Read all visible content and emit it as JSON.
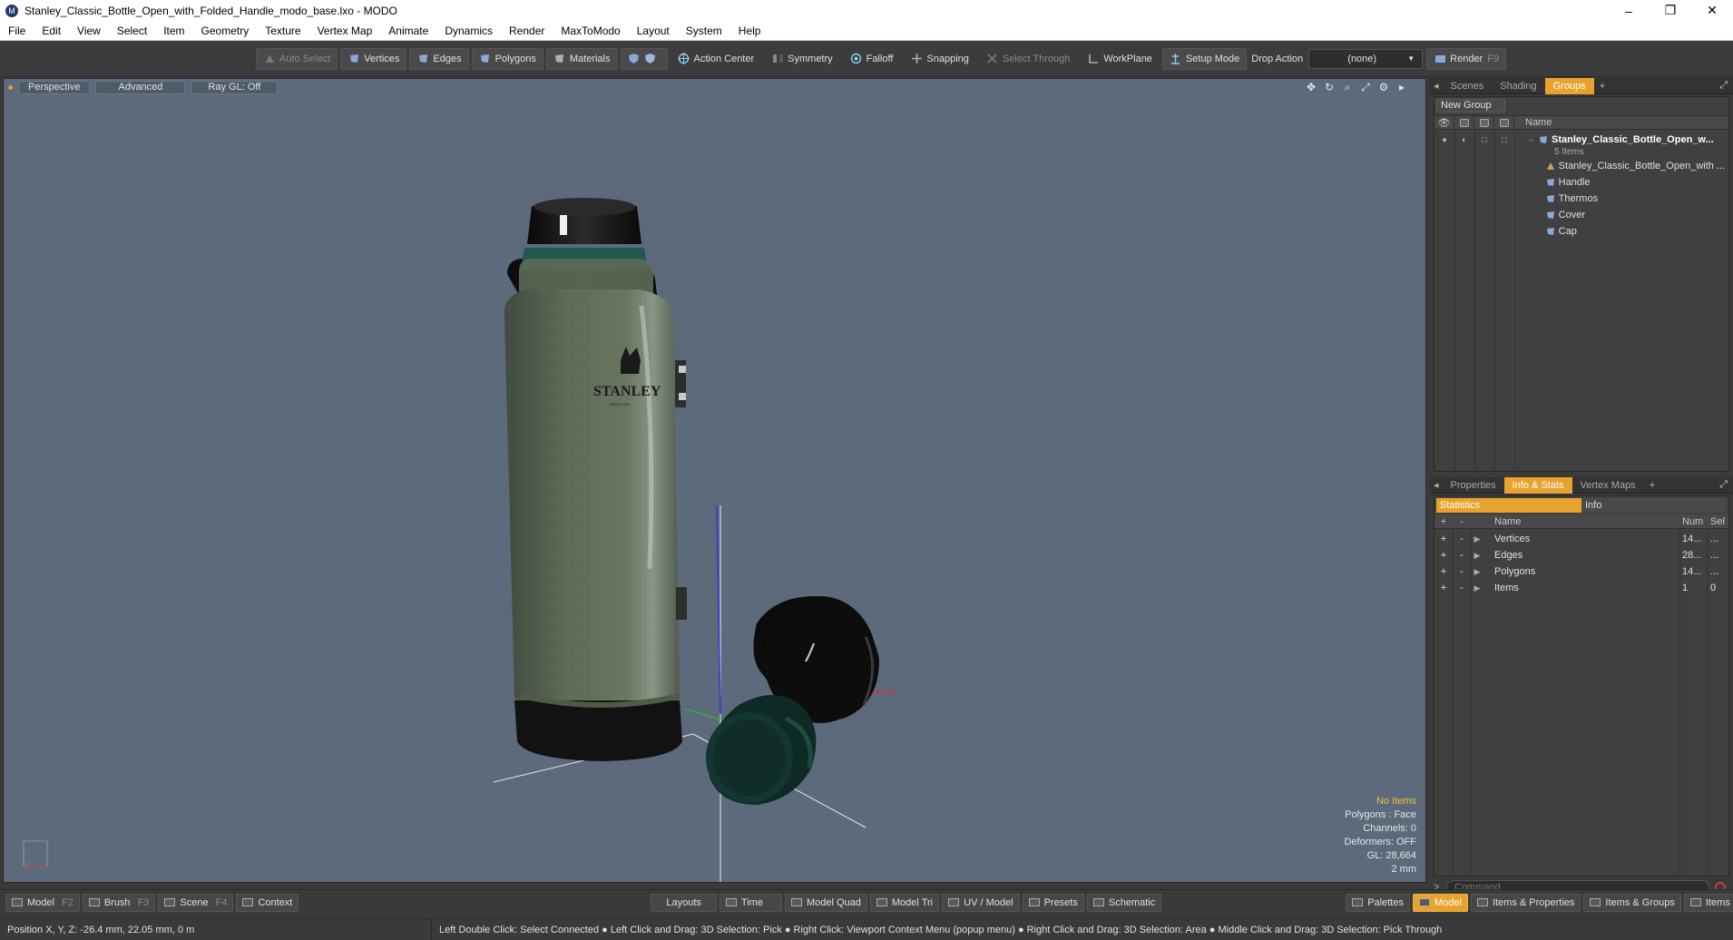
{
  "window": {
    "title": "Stanley_Classic_Bottle_Open_with_Folded_Handle_modo_base.lxo - MODO",
    "minimize": "–",
    "restore": "❐",
    "close": "✕"
  },
  "menu": [
    "File",
    "Edit",
    "View",
    "Select",
    "Item",
    "Geometry",
    "Texture",
    "Vertex Map",
    "Animate",
    "Dynamics",
    "Render",
    "MaxToModo",
    "Layout",
    "System",
    "Help"
  ],
  "toolbar": {
    "auto_select": "Auto Select",
    "vertices": "Vertices",
    "edges": "Edges",
    "polygons": "Polygons",
    "materials": "Materials",
    "action_center": "Action Center",
    "symmetry": "Symmetry",
    "falloff": "Falloff",
    "snapping": "Snapping",
    "select_through": "Select Through",
    "workplane": "WorkPlane",
    "setup_mode": "Setup Mode",
    "drop_action": "Drop Action",
    "drop_value": "(none)",
    "render": "Render",
    "render_key": "F9"
  },
  "viewport": {
    "tabs": [
      "Perspective",
      "Advanced",
      "Ray GL: Off"
    ],
    "info": {
      "items": "No Items",
      "polygons": "Polygons : Face",
      "channels": "Channels: 0",
      "deformers": "Deformers: OFF",
      "gl": "GL: 28,664",
      "scale": "2 mm"
    },
    "brand_text": "STANLEY",
    "brand_sub": "SINCE 1913"
  },
  "groups_panel": {
    "tabs": [
      "Scenes",
      "Shading",
      "Groups"
    ],
    "active_tab": "Groups",
    "new_group": "New Group",
    "name_header": "Name",
    "root": {
      "label": "Stanley_Classic_Bottle_Open_w...",
      "count": "5 Items"
    },
    "children": [
      "Stanley_Classic_Bottle_Open_with ...",
      "Handle",
      "Thermos",
      "Cover",
      "Cap"
    ]
  },
  "stats_panel": {
    "tabs": [
      "Properties",
      "Info & Stats",
      "Vertex Maps"
    ],
    "active_tab": "Info & Stats",
    "sub_tabs": [
      "Statistics",
      "Info"
    ],
    "headers": {
      "name": "Name",
      "num": "Num",
      "sel": "Sel"
    },
    "rows": [
      {
        "name": "Vertices",
        "num": "14...",
        "sel": "..."
      },
      {
        "name": "Edges",
        "num": "28...",
        "sel": "..."
      },
      {
        "name": "Polygons",
        "num": "14...",
        "sel": "..."
      },
      {
        "name": "Items",
        "num": "1",
        "sel": "0"
      }
    ],
    "command_placeholder": "Command"
  },
  "bottombar": {
    "left": [
      {
        "label": "Model",
        "key": "F2"
      },
      {
        "label": "Brush",
        "key": "F3"
      },
      {
        "label": "Scene",
        "key": "F4"
      },
      {
        "label": "Context",
        "key": ""
      }
    ],
    "center": [
      "Layouts",
      "Time",
      "Model Quad",
      "Model Tri",
      "UV / Model",
      "Presets",
      "Schematic"
    ],
    "right": [
      "Palettes",
      "Model",
      "Items & Properties",
      "Items & Groups",
      "Items & Shading"
    ]
  },
  "statusbar": {
    "position": "Position X, Y, Z:  -26.4 mm, 22.05 mm, 0 m",
    "hint": "Left Double Click: Select Connected ● Left Click and Drag: 3D Selection: Pick ● Right Click: Viewport Context Menu (popup menu) ● Right Click and Drag: 3D Selection: Area ● Middle Click and Drag: 3D Selection: Pick Through"
  },
  "colors": {
    "accent": "#e8a22e",
    "viewport_bg": "#5c6a7b",
    "bottle_body": "#5c6a56",
    "bottle_dark": "#121212",
    "teal_ring": "#1e5a4e"
  }
}
